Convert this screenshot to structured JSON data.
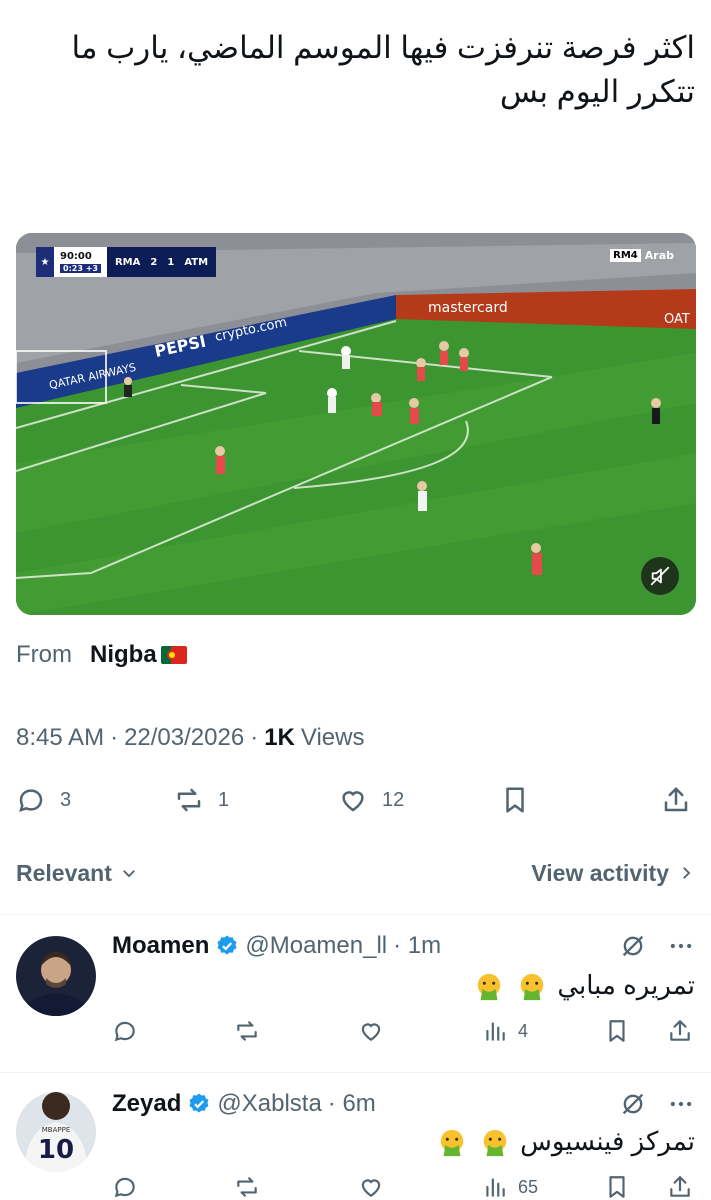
{
  "tweet": {
    "text": "اكثر فرصة تنرفزت فيها الموسم الماضي، يارب ما تتكرر اليوم بس"
  },
  "video": {
    "scorebug": {
      "clock": "90:00",
      "added_clock": "0:23",
      "added_minutes": "+3",
      "home": "RMA",
      "home_score": "2",
      "away_score": "1",
      "away": "ATM"
    },
    "broadcaster": {
      "box": "RM4",
      "label": "Arab"
    },
    "boards": [
      "mastercard",
      "PEPSI",
      "crypto.com",
      "QATAR AIRWAYS",
      "OAT"
    ]
  },
  "source": {
    "from_label": "From",
    "name": "Nigba"
  },
  "meta": {
    "time": "8:45 AM",
    "date": "22/03/2026",
    "views_count": "1K",
    "views_label": "Views",
    "sep": "·"
  },
  "actions": {
    "replies": "3",
    "reposts": "1",
    "likes": "12"
  },
  "sort": {
    "relevant_label": "Relevant",
    "view_activity_label": "View activity"
  },
  "replies": [
    {
      "name": "Moamen",
      "handle": "@Moamen_ll",
      "time": "· 1m",
      "text": "تمريره مبابي",
      "views": "4"
    },
    {
      "name": "Zeyad",
      "handle": "@Xablsta",
      "time": "· 6m",
      "text": "تمركز فينسيوس",
      "views": "65",
      "jersey_number": "10",
      "jersey_name": "MBAPPE"
    }
  ],
  "colors": {
    "text": "#0f1419",
    "secondary": "#536471",
    "verified": "#1d9bf0",
    "divider": "#eff3f4"
  }
}
